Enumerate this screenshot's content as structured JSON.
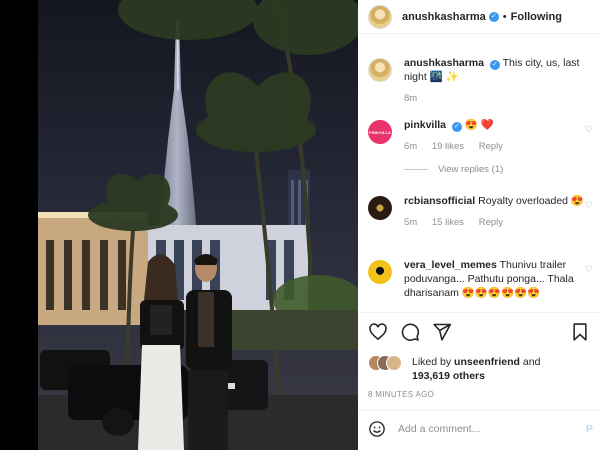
{
  "header": {
    "username": "anushkasharma",
    "verified_mark": "✓",
    "separator": "•",
    "follow_status": "Following"
  },
  "caption": {
    "username": "anushkasharma",
    "text": "This city, us, last night 🌃 ✨",
    "time": "8m"
  },
  "comments": [
    {
      "username": "pinkvilla",
      "avatar_text": "PINKVILLA",
      "text": "😍 ❤️",
      "time": "6m",
      "likes": "19 likes",
      "reply": "Reply"
    },
    {
      "username": "rcbiansofficial",
      "text": "Royalty overloaded 😍",
      "time": "5m",
      "likes": "15 likes",
      "reply": "Reply"
    },
    {
      "username": "vera_level_memes",
      "text": "Thunivu trailer poduvanga... Pathutu ponga... Thala dharisanam 😍😍😍😍😍😍"
    }
  ],
  "view_replies": "View replies (1)",
  "likes": {
    "prefix": "Liked by ",
    "liked_user": "unseenfriend",
    "joiner": " and",
    "count": "193,619 others"
  },
  "timestamp": "8 MINUTES AGO",
  "add_comment": {
    "placeholder": "Add a comment...",
    "post": "P"
  },
  "icons": [
    "heart-icon",
    "comment-icon",
    "share-icon",
    "save-icon",
    "emoji-icon",
    "verified-icon"
  ],
  "colors": {
    "verified": "#3897f0",
    "like_heart": "#ed4956",
    "muted": "#8e8e8e",
    "post_button": "#b2dffc"
  }
}
